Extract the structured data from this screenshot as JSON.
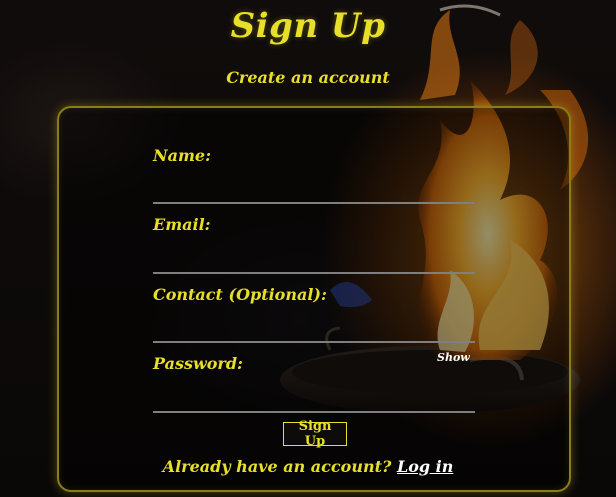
{
  "page": {
    "title": "Sign Up",
    "subtitle": "Create an account"
  },
  "form": {
    "name_label": "Name:",
    "name_value": "",
    "email_label": "Email:",
    "email_value": "",
    "contact_label": "Contact (Optional):",
    "contact_value": "",
    "password_label": "Password:",
    "password_value": "",
    "show_label": "Show",
    "submit_label": "Sign Up"
  },
  "footer": {
    "prompt": "Already have an account?",
    "login_link": "Log in"
  },
  "colors": {
    "accent": "#e7df2a",
    "background": "#0b0807",
    "card_border": "#8a7f16",
    "input_underline": "#7f7f7f",
    "link": "#ffffff"
  },
  "icons": {
    "background_scene": "flaming-pan-image"
  }
}
